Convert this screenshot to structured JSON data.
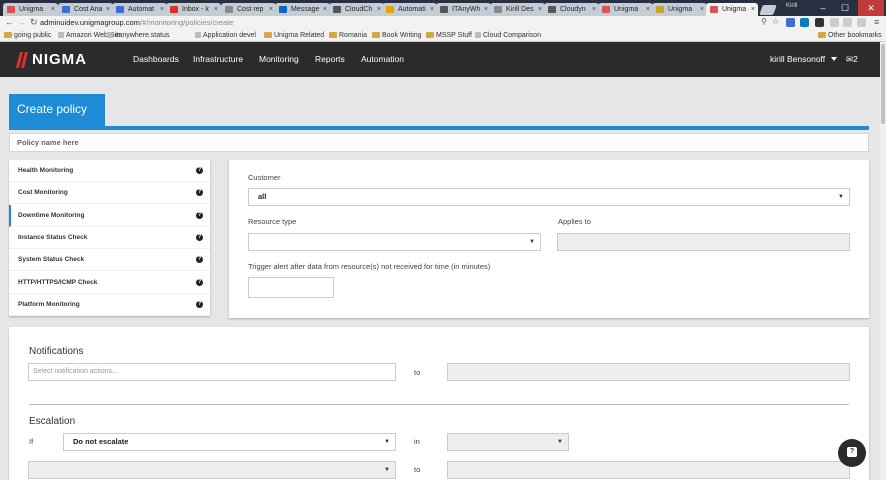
{
  "browser": {
    "tabs": [
      {
        "title": "Unigma",
        "color": "#d9534f"
      },
      {
        "title": "Cost Ana",
        "color": "#3b6fd4"
      },
      {
        "title": "Automat",
        "color": "#3b6fd4"
      },
      {
        "title": "Inbox - k",
        "color": "#d93025"
      },
      {
        "title": "Cost rep",
        "color": "#888888"
      },
      {
        "title": "Message",
        "color": "#0a66c2"
      },
      {
        "title": "CloudCh",
        "color": "#555555"
      },
      {
        "title": "Automati",
        "color": "#e0a800"
      },
      {
        "title": "ITAnyWh",
        "color": "#555555"
      },
      {
        "title": "Kirill Des",
        "color": "#888888"
      },
      {
        "title": "Cloudyn",
        "color": "#555555"
      },
      {
        "title": "Unigma",
        "color": "#d9534f"
      },
      {
        "title": "Unigma",
        "color": "#c9a227"
      },
      {
        "title": "Unigma",
        "color": "#d9534f",
        "active": true
      }
    ],
    "window_user": "Kirill",
    "url_host": "adminuidev.unigmagroup.com",
    "url_path": "/#/monitoring/policies/create",
    "bookmarks": [
      {
        "label": "going public",
        "folder": true
      },
      {
        "label": "Amazon Web Ser",
        "folder": false
      },
      {
        "label": "itanywhere.status",
        "folder": false
      },
      {
        "label": "Application devel",
        "folder": false
      },
      {
        "label": "Unigma Related",
        "folder": true
      },
      {
        "label": "Romania",
        "folder": true
      },
      {
        "label": "Book Writing",
        "folder": true
      },
      {
        "label": "MSSP Stuff",
        "folder": true
      },
      {
        "label": "Cloud Comparison",
        "folder": false
      }
    ],
    "other_bookmarks": "Other bookmarks"
  },
  "app": {
    "logo": "NIGMA",
    "menu": [
      "Dashboards",
      "Infrastructure",
      "Monitoring",
      "Reports",
      "Automation"
    ],
    "user_name": "kirill Bensonoff",
    "mail_count": "2"
  },
  "page": {
    "title": "Create policy",
    "policy_name_placeholder": "Policy name here",
    "sidebar": [
      "Health Monitoring",
      "Cost Monitoring",
      "Downtime Monitoring",
      "Instance Status Check",
      "System Status Check",
      "HTTP/HTTPS/ICMP Check",
      "Platform Monitoring"
    ],
    "active_sidebar": "Downtime Monitoring",
    "customer_label": "Customer",
    "customer_value": "all",
    "resource_type_label": "Resource type",
    "applies_to_label": "Applies to",
    "trigger_label": "Trigger alert after data from resource(s) not received for time (in minutes)",
    "notifications_title": "Notifications",
    "notifications_placeholder": "Select notification actions...",
    "to_label": "to",
    "escalation_title": "Escalation",
    "if_label": "If",
    "escalate_value": "Do not escalate",
    "in_label": "in"
  }
}
